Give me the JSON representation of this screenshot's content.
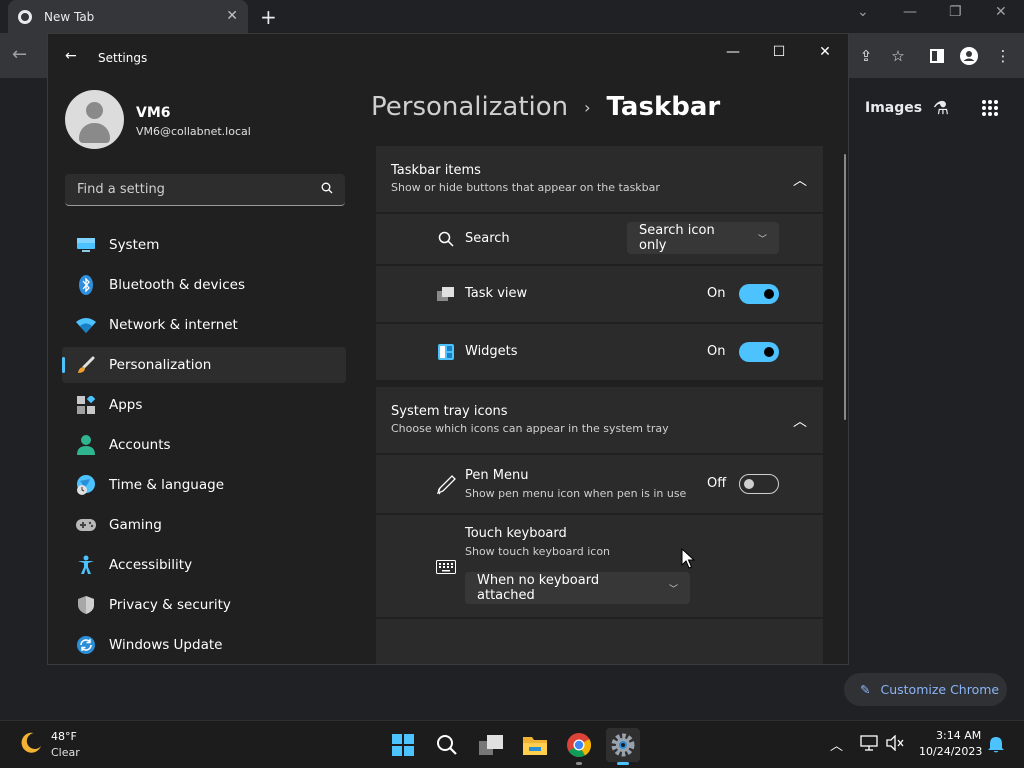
{
  "chrome": {
    "tab_title": "New Tab",
    "new_tab_label": "+",
    "images_link": "Images",
    "customize_label": "Customize Chrome"
  },
  "settings": {
    "title": "Settings",
    "profile": {
      "name": "VM6",
      "email": "VM6@collabnet.local"
    },
    "search": {
      "placeholder": "Find a setting",
      "value": ""
    },
    "nav": [
      {
        "label": "System",
        "icon": "system-icon",
        "active": false
      },
      {
        "label": "Bluetooth & devices",
        "icon": "bluetooth-icon",
        "active": false
      },
      {
        "label": "Network & internet",
        "icon": "wifi-icon",
        "active": false
      },
      {
        "label": "Personalization",
        "icon": "brush-icon",
        "active": true
      },
      {
        "label": "Apps",
        "icon": "apps-icon",
        "active": false
      },
      {
        "label": "Accounts",
        "icon": "accounts-icon",
        "active": false
      },
      {
        "label": "Time & language",
        "icon": "globe-clock-icon",
        "active": false
      },
      {
        "label": "Gaming",
        "icon": "gamepad-icon",
        "active": false
      },
      {
        "label": "Accessibility",
        "icon": "accessibility-icon",
        "active": false
      },
      {
        "label": "Privacy & security",
        "icon": "shield-icon",
        "active": false
      },
      {
        "label": "Windows Update",
        "icon": "update-icon",
        "active": false
      }
    ],
    "breadcrumb": {
      "parent": "Personalization",
      "separator": "›",
      "current": "Taskbar"
    },
    "taskbar_items": {
      "title": "Taskbar items",
      "subtitle": "Show or hide buttons that appear on the taskbar",
      "search": {
        "label": "Search",
        "value": "Search icon only"
      },
      "task_view": {
        "label": "Task view",
        "state": "On"
      },
      "widgets": {
        "label": "Widgets",
        "state": "On"
      }
    },
    "system_tray": {
      "title": "System tray icons",
      "subtitle": "Choose which icons can appear in the system tray",
      "pen_menu": {
        "label": "Pen Menu",
        "desc": "Show pen menu icon when pen is in use",
        "state": "Off"
      },
      "touch_keyboard": {
        "label": "Touch keyboard",
        "desc": "Show touch keyboard icon",
        "value": "When no keyboard attached"
      }
    }
  },
  "taskbar": {
    "weather": {
      "temp": "48°F",
      "condition": "Clear"
    },
    "clock": {
      "time": "3:14 AM",
      "date": "10/24/2023"
    }
  },
  "colors": {
    "accent": "#4cc2ff",
    "window_bg": "#202020",
    "card_bg": "#2b2b2b"
  }
}
